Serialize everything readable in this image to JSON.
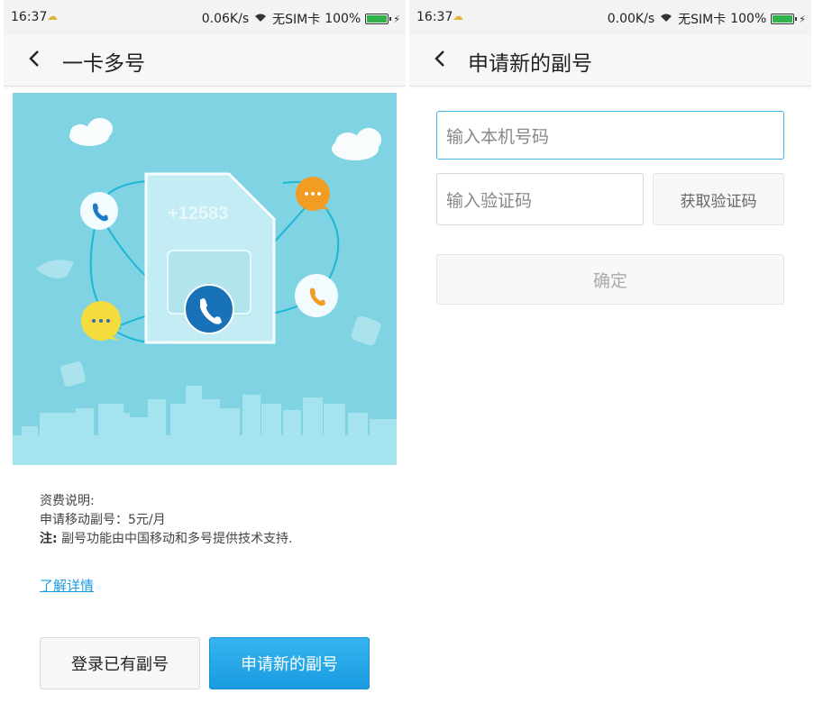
{
  "left": {
    "status": {
      "time": "16:37",
      "speed": "0.06K/s",
      "sim": "无SIM卡",
      "battery": "100%",
      "battery_level": 1.0
    },
    "title": "一卡多号",
    "banner": {
      "number": "+12583"
    },
    "info": {
      "line1": "资费说明:",
      "line2": "申请移动副号：5元/月",
      "note_label": "注:",
      "note_text": "副号功能由中国移动和多号提供技术支持."
    },
    "link": "了解详情",
    "buttons": {
      "login": "登录已有副号",
      "apply": "申请新的副号"
    }
  },
  "right": {
    "status": {
      "time": "16:37",
      "speed": "0.00K/s",
      "sim": "无SIM卡",
      "battery": "100%",
      "battery_level": 1.0
    },
    "title": "申请新的副号",
    "phone_placeholder": "输入本机号码",
    "code_placeholder": "输入验证码",
    "get_code": "获取验证码",
    "confirm": "确定"
  },
  "colors": {
    "accent": "#1a9be0",
    "banner_bg": "#7fd3e3",
    "battery": "#2fb34a"
  }
}
